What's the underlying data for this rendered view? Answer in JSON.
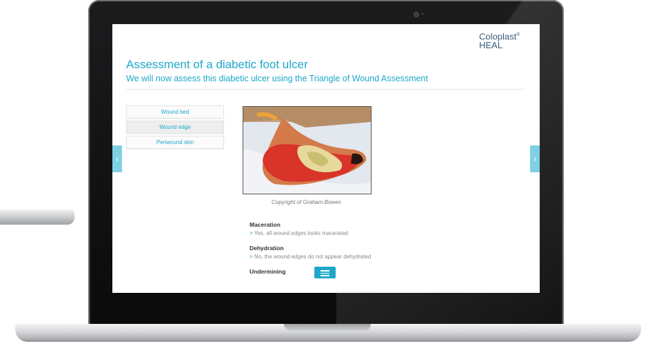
{
  "brand": {
    "name": "Coloplast",
    "registered": "®",
    "product": "HEAL"
  },
  "page": {
    "title": "Assessment of a diabetic foot ulcer",
    "subtitle": "We will now assess this diabetic ulcer using the Triangle of Wound Assessment"
  },
  "tabs": [
    {
      "label": "Wound bed",
      "active": false
    },
    {
      "label": "Wound edge",
      "active": true
    },
    {
      "label": "Periwound skin",
      "active": false
    }
  ],
  "nav": {
    "prev_icon": "chevron-left-icon",
    "next_icon": "chevron-right-icon"
  },
  "image": {
    "caption": "Copyright of Graham Bowen"
  },
  "assessment": [
    {
      "title": "Maceration",
      "value": "Yes, all wound edges looks macerated"
    },
    {
      "title": "Dehydration",
      "value": "No, the wound edges do not appear dehydrated"
    },
    {
      "title": "Undermining",
      "action_icon": "menu-icon"
    }
  ],
  "colors": {
    "accent": "#1ea7c9",
    "nav_arrow": "#7fd0e3",
    "brand": "#3b5d7a"
  }
}
